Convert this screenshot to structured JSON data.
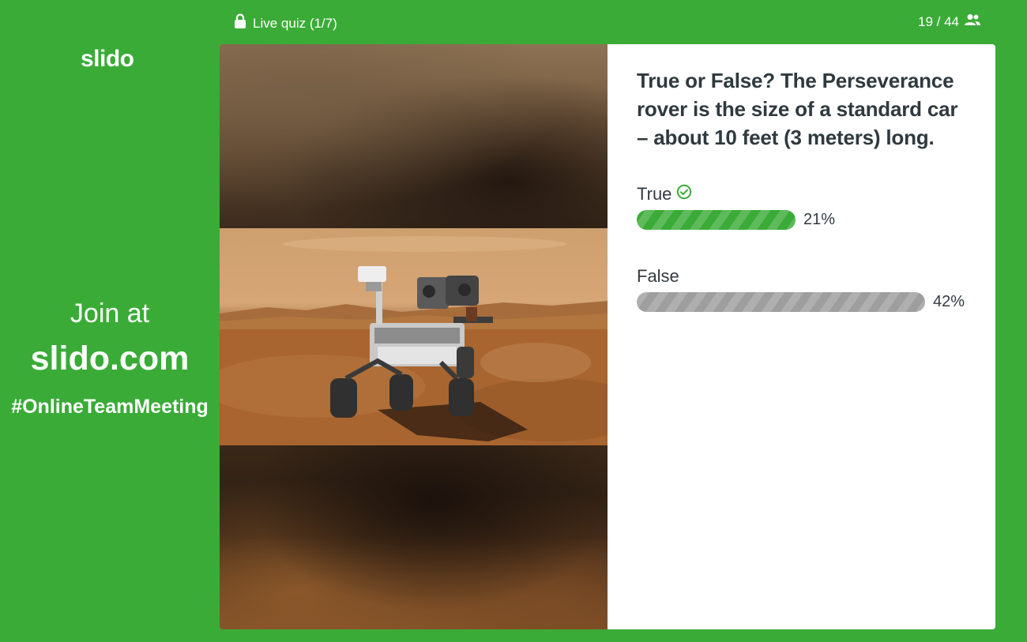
{
  "topbar": {
    "status_label": "Live quiz (1/7)",
    "participants": "19 / 44"
  },
  "sidebar": {
    "logo_text": "slido",
    "join_prefix": "Join at",
    "join_url": "slido.com",
    "event_code": "#OnlineTeamMeeting"
  },
  "quiz": {
    "question": "True or False? The Perseverance rover is the size of a standard car – about 10 feet (3 meters) long.",
    "options": [
      {
        "label": "True",
        "percent_text": "21%",
        "fill_fraction": 0.55,
        "correct": true
      },
      {
        "label": "False",
        "percent_text": "42%",
        "fill_fraction": 1.0,
        "correct": false
      }
    ]
  },
  "colors": {
    "background": "#3aab37",
    "correct_bar": "#3aab37",
    "wrong_bar": "#9e9e9e",
    "text_dark": "#2f3a3f"
  },
  "icons": {
    "status": "lock-icon",
    "participants": "people-icon",
    "correct": "check-circle-icon"
  }
}
